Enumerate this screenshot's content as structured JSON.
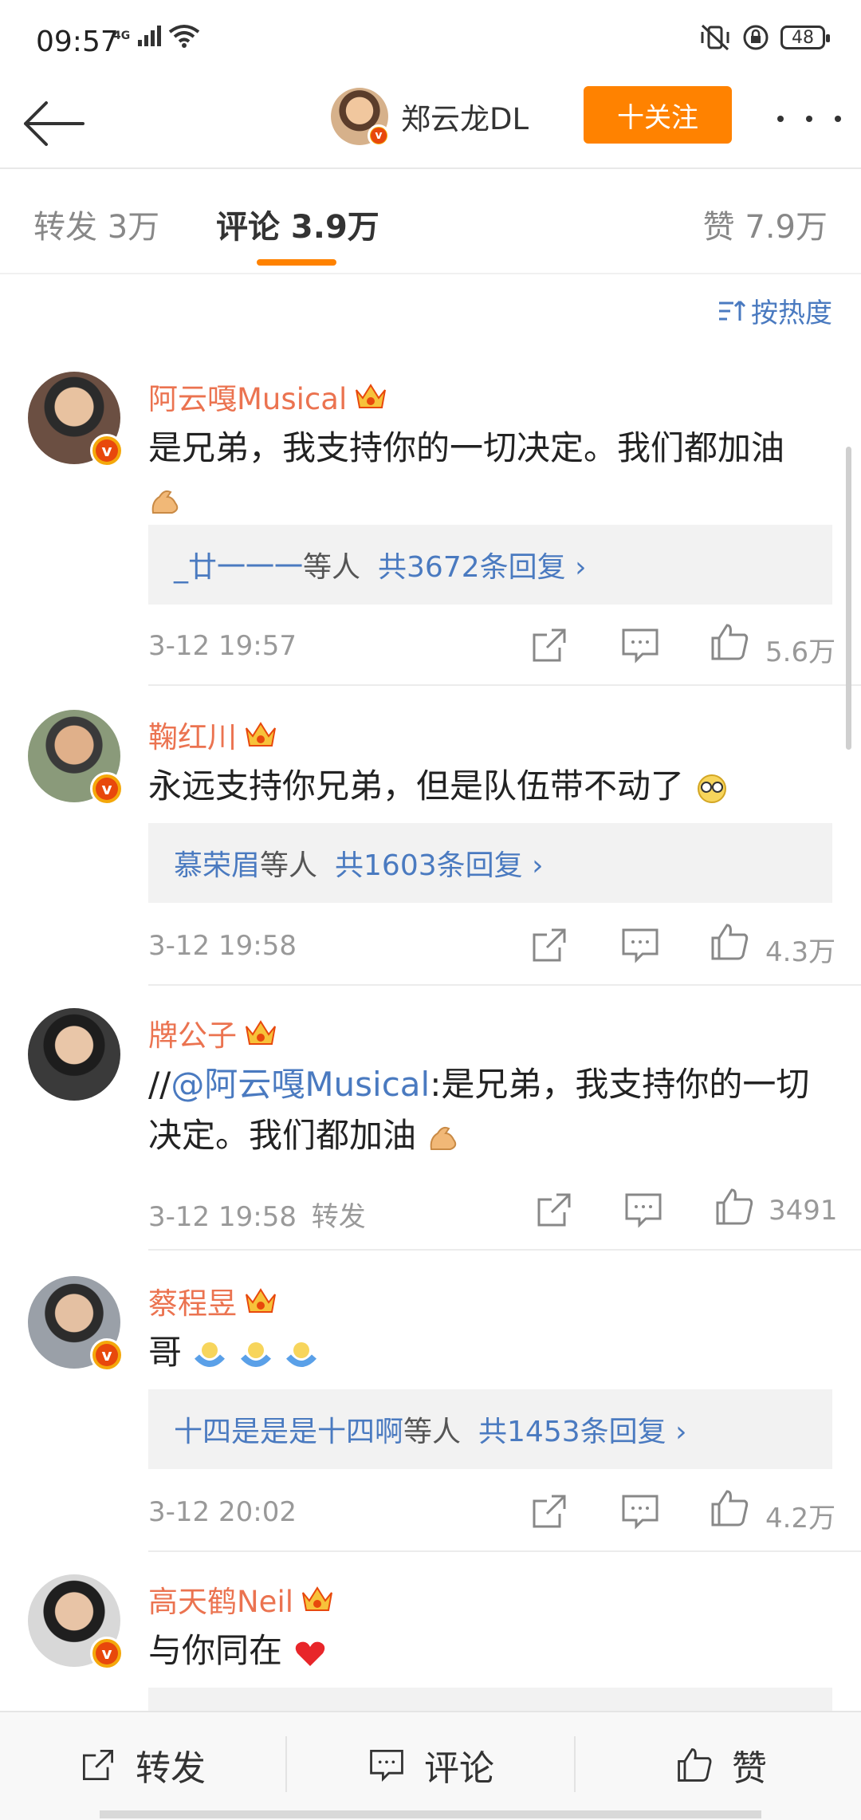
{
  "status": {
    "time": "09:57",
    "network": "4G",
    "battery": "48"
  },
  "nav": {
    "user_name": "郑云龙DL",
    "follow_label": "十关注"
  },
  "tabs": {
    "repost": "转发 3万",
    "comment": "评论 3.9万",
    "like": "赞 7.9万"
  },
  "sort_label": "按热度",
  "comments": [
    {
      "name": "阿云嘎Musical",
      "text_line1": "是兄弟，我支持你的一切决定。我们都加油",
      "reply_names": "_廿一一一",
      "reply_mid": "等人",
      "reply_count": "共3672条回复 ›",
      "time": "3-12 19:57",
      "likes": "5.6万"
    },
    {
      "name": "鞠红川",
      "text": "永远支持你兄弟，但是队伍带不动了",
      "reply_names": "慕荣眉",
      "reply_mid": "等人",
      "reply_count": "共1603条回复 ›",
      "time": "3-12 19:58",
      "likes": "4.3万"
    },
    {
      "name": "牌公子",
      "text_prefix": "//",
      "mention": "@阿云嘎Musical",
      "text_rest": ":是兄弟，我支持你的一切",
      "text_line2": "决定。我们都加油",
      "time": "3-12 19:58",
      "repost_tag": "转发",
      "likes": "3491"
    },
    {
      "name": "蔡程昱",
      "text": "哥",
      "reply_names": "十四是是是十四啊",
      "reply_mid": "等人",
      "reply_count": "共1453条回复 ›",
      "time": "3-12 20:02",
      "likes": "4.2万"
    },
    {
      "name": "高天鹤Neil",
      "text": "与你同在"
    }
  ],
  "bottom": {
    "repost": "转发",
    "comment": "评论",
    "like": "赞"
  },
  "colors": {
    "accent": "#ff8200",
    "name": "#eb7350",
    "link": "#4a7ac0"
  }
}
